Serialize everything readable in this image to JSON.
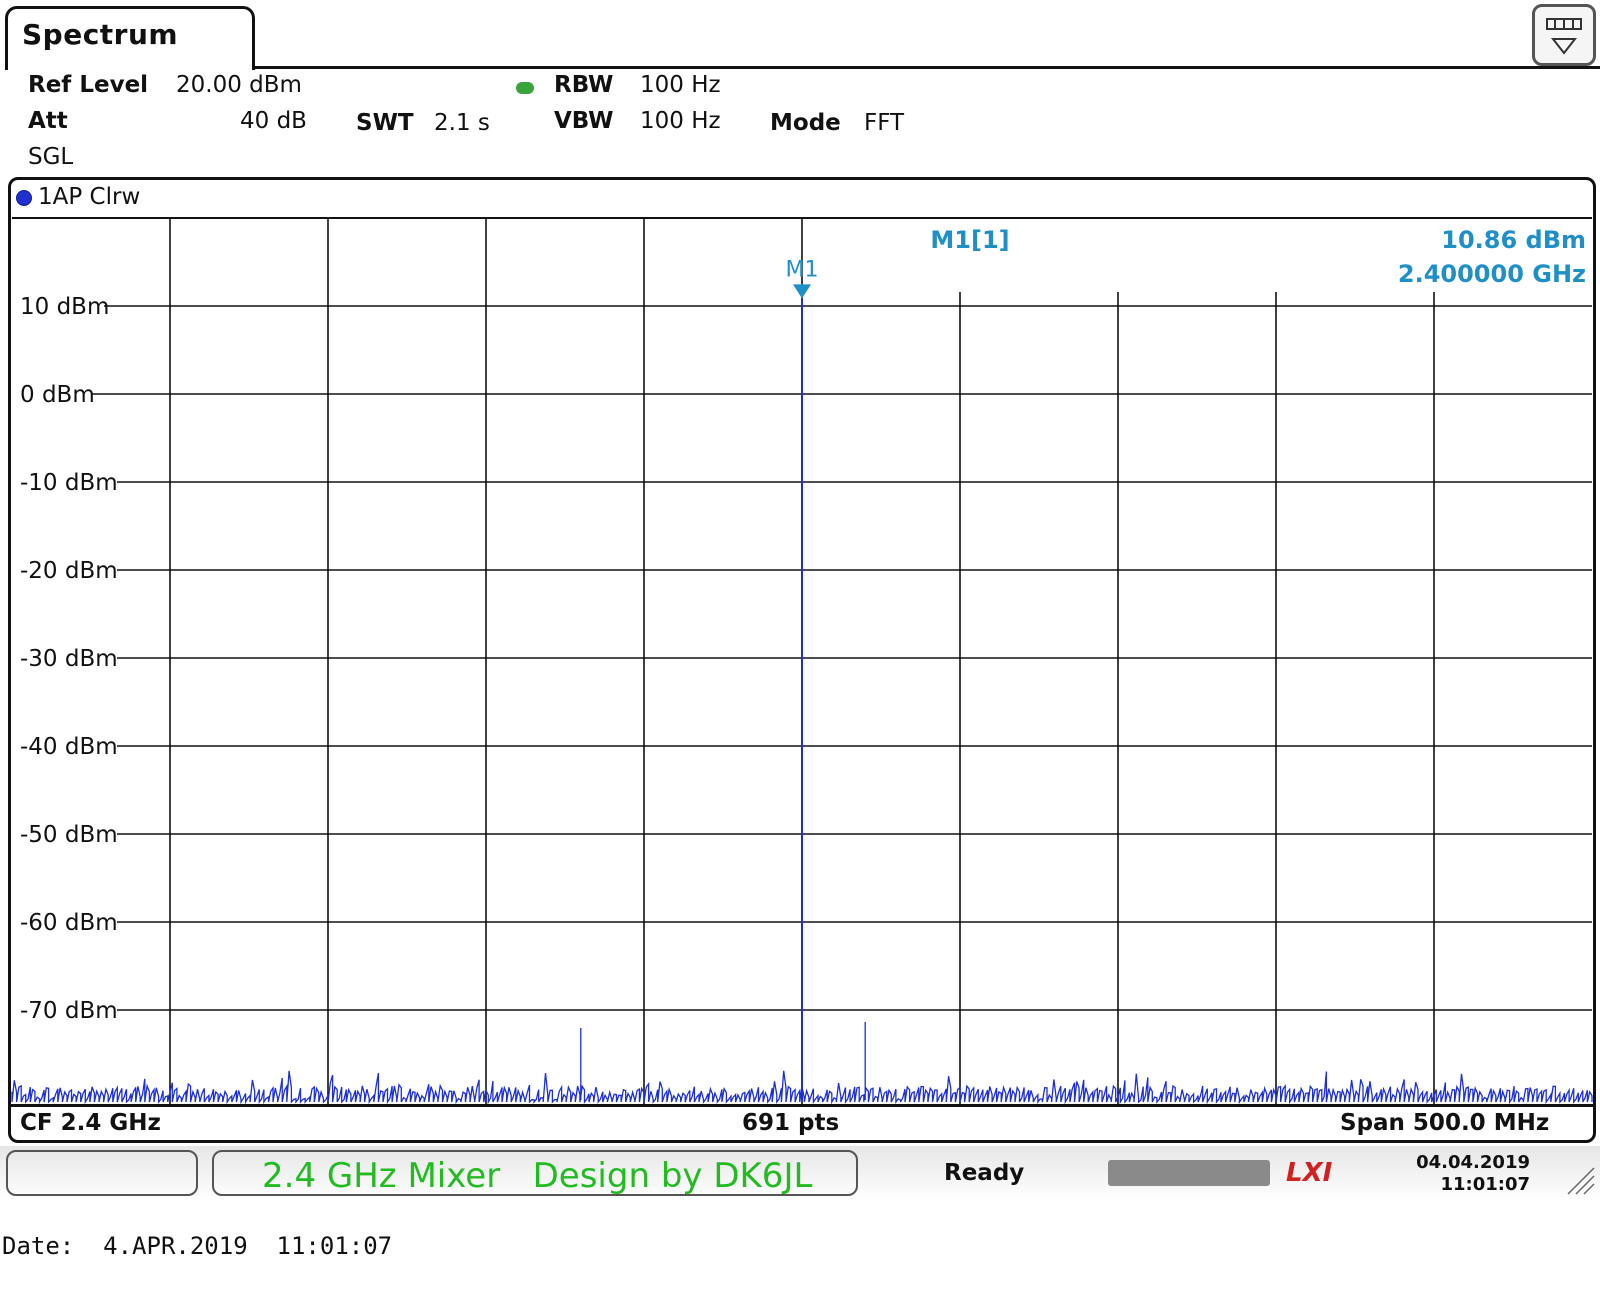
{
  "tab": {
    "title": "Spectrum"
  },
  "settings": {
    "ref_level_label": "Ref Level",
    "ref_level_value": "20.00 dBm",
    "att_label": "Att",
    "att_value": "40 dB",
    "swt_label": "SWT",
    "swt_value": "2.1 s",
    "rbw_label": "RBW",
    "rbw_value": "100 Hz",
    "vbw_label": "VBW",
    "vbw_value": "100 Hz",
    "mode_label": "Mode",
    "mode_value": "FFT",
    "sweep_mode": "SGL"
  },
  "trace": {
    "label": "1AP Clrw"
  },
  "marker": {
    "name": "M1",
    "readout_label": "M1[1]",
    "level": "10.86 dBm",
    "frequency": "2.400000 GHz"
  },
  "bottom_axis": {
    "center": "CF 2.4 GHz",
    "points": "691 pts",
    "span": "Span 500.0 MHz"
  },
  "status": {
    "message": "2.4 GHz Mixer   Design by DK6JL",
    "state": "Ready",
    "logo": "LXI",
    "date": "04.04.2019",
    "time": "11:01:07"
  },
  "footer": {
    "text": "Date:  4.APR.2019  11:01:07"
  },
  "colors": {
    "trace": "#1a2fd6",
    "marker": "#1f8fc8",
    "status_text": "#22bb22"
  },
  "chart_data": {
    "type": "line",
    "yticks": [
      "10 dBm",
      "0 dBm",
      "-10 dBm",
      "-20 dBm",
      "-30 dBm",
      "-40 dBm",
      "-50 dBm",
      "-60 dBm",
      "-70 dBm"
    ],
    "ylim": [
      -80,
      20
    ],
    "xlim": [
      2.15,
      2.65
    ],
    "x_unit": "GHz",
    "noise_floor_dbm": -77,
    "peaks": [
      {
        "x": 2.4,
        "y": 10.86
      },
      {
        "x": 2.4,
        "y": -72
      },
      {
        "x": 2.42,
        "y": -74
      },
      {
        "x": 2.33,
        "y": -75
      }
    ],
    "grid": true
  }
}
